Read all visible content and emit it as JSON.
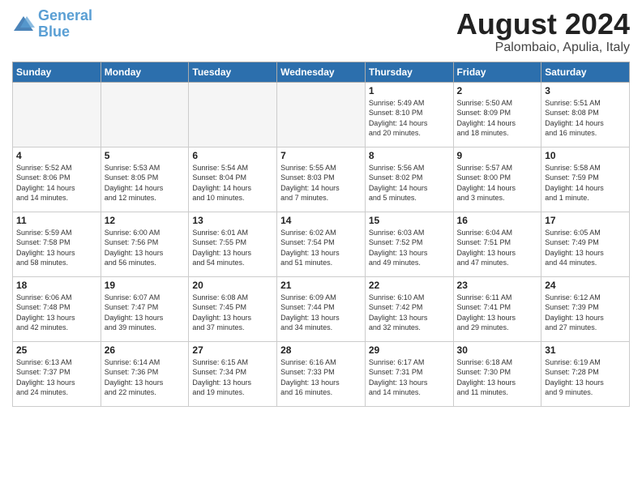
{
  "logo": {
    "line1": "General",
    "line2": "Blue"
  },
  "title": "August 2024",
  "subtitle": "Palombaio, Apulia, Italy",
  "headers": [
    "Sunday",
    "Monday",
    "Tuesday",
    "Wednesday",
    "Thursday",
    "Friday",
    "Saturday"
  ],
  "weeks": [
    [
      {
        "day": "",
        "info": ""
      },
      {
        "day": "",
        "info": ""
      },
      {
        "day": "",
        "info": ""
      },
      {
        "day": "",
        "info": ""
      },
      {
        "day": "1",
        "info": "Sunrise: 5:49 AM\nSunset: 8:10 PM\nDaylight: 14 hours\nand 20 minutes."
      },
      {
        "day": "2",
        "info": "Sunrise: 5:50 AM\nSunset: 8:09 PM\nDaylight: 14 hours\nand 18 minutes."
      },
      {
        "day": "3",
        "info": "Sunrise: 5:51 AM\nSunset: 8:08 PM\nDaylight: 14 hours\nand 16 minutes."
      }
    ],
    [
      {
        "day": "4",
        "info": "Sunrise: 5:52 AM\nSunset: 8:06 PM\nDaylight: 14 hours\nand 14 minutes."
      },
      {
        "day": "5",
        "info": "Sunrise: 5:53 AM\nSunset: 8:05 PM\nDaylight: 14 hours\nand 12 minutes."
      },
      {
        "day": "6",
        "info": "Sunrise: 5:54 AM\nSunset: 8:04 PM\nDaylight: 14 hours\nand 10 minutes."
      },
      {
        "day": "7",
        "info": "Sunrise: 5:55 AM\nSunset: 8:03 PM\nDaylight: 14 hours\nand 7 minutes."
      },
      {
        "day": "8",
        "info": "Sunrise: 5:56 AM\nSunset: 8:02 PM\nDaylight: 14 hours\nand 5 minutes."
      },
      {
        "day": "9",
        "info": "Sunrise: 5:57 AM\nSunset: 8:00 PM\nDaylight: 14 hours\nand 3 minutes."
      },
      {
        "day": "10",
        "info": "Sunrise: 5:58 AM\nSunset: 7:59 PM\nDaylight: 14 hours\nand 1 minute."
      }
    ],
    [
      {
        "day": "11",
        "info": "Sunrise: 5:59 AM\nSunset: 7:58 PM\nDaylight: 13 hours\nand 58 minutes."
      },
      {
        "day": "12",
        "info": "Sunrise: 6:00 AM\nSunset: 7:56 PM\nDaylight: 13 hours\nand 56 minutes."
      },
      {
        "day": "13",
        "info": "Sunrise: 6:01 AM\nSunset: 7:55 PM\nDaylight: 13 hours\nand 54 minutes."
      },
      {
        "day": "14",
        "info": "Sunrise: 6:02 AM\nSunset: 7:54 PM\nDaylight: 13 hours\nand 51 minutes."
      },
      {
        "day": "15",
        "info": "Sunrise: 6:03 AM\nSunset: 7:52 PM\nDaylight: 13 hours\nand 49 minutes."
      },
      {
        "day": "16",
        "info": "Sunrise: 6:04 AM\nSunset: 7:51 PM\nDaylight: 13 hours\nand 47 minutes."
      },
      {
        "day": "17",
        "info": "Sunrise: 6:05 AM\nSunset: 7:49 PM\nDaylight: 13 hours\nand 44 minutes."
      }
    ],
    [
      {
        "day": "18",
        "info": "Sunrise: 6:06 AM\nSunset: 7:48 PM\nDaylight: 13 hours\nand 42 minutes."
      },
      {
        "day": "19",
        "info": "Sunrise: 6:07 AM\nSunset: 7:47 PM\nDaylight: 13 hours\nand 39 minutes."
      },
      {
        "day": "20",
        "info": "Sunrise: 6:08 AM\nSunset: 7:45 PM\nDaylight: 13 hours\nand 37 minutes."
      },
      {
        "day": "21",
        "info": "Sunrise: 6:09 AM\nSunset: 7:44 PM\nDaylight: 13 hours\nand 34 minutes."
      },
      {
        "day": "22",
        "info": "Sunrise: 6:10 AM\nSunset: 7:42 PM\nDaylight: 13 hours\nand 32 minutes."
      },
      {
        "day": "23",
        "info": "Sunrise: 6:11 AM\nSunset: 7:41 PM\nDaylight: 13 hours\nand 29 minutes."
      },
      {
        "day": "24",
        "info": "Sunrise: 6:12 AM\nSunset: 7:39 PM\nDaylight: 13 hours\nand 27 minutes."
      }
    ],
    [
      {
        "day": "25",
        "info": "Sunrise: 6:13 AM\nSunset: 7:37 PM\nDaylight: 13 hours\nand 24 minutes."
      },
      {
        "day": "26",
        "info": "Sunrise: 6:14 AM\nSunset: 7:36 PM\nDaylight: 13 hours\nand 22 minutes."
      },
      {
        "day": "27",
        "info": "Sunrise: 6:15 AM\nSunset: 7:34 PM\nDaylight: 13 hours\nand 19 minutes."
      },
      {
        "day": "28",
        "info": "Sunrise: 6:16 AM\nSunset: 7:33 PM\nDaylight: 13 hours\nand 16 minutes."
      },
      {
        "day": "29",
        "info": "Sunrise: 6:17 AM\nSunset: 7:31 PM\nDaylight: 13 hours\nand 14 minutes."
      },
      {
        "day": "30",
        "info": "Sunrise: 6:18 AM\nSunset: 7:30 PM\nDaylight: 13 hours\nand 11 minutes."
      },
      {
        "day": "31",
        "info": "Sunrise: 6:19 AM\nSunset: 7:28 PM\nDaylight: 13 hours\nand 9 minutes."
      }
    ]
  ]
}
